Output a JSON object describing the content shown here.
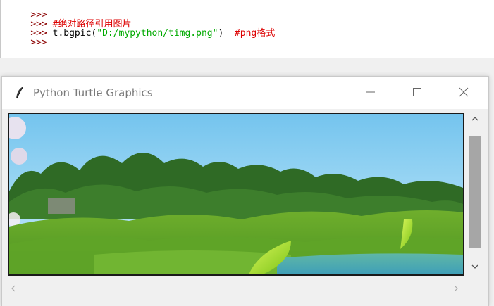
{
  "shell": {
    "lines": [
      {
        "prompt": ">>>",
        "segments": []
      },
      {
        "prompt": ">>>",
        "segments": [
          {
            "kind": "comment",
            "text": " #绝对路径引用图片"
          }
        ]
      },
      {
        "prompt": ">>>",
        "segments": [
          {
            "kind": "code",
            "text": " t.bgpic("
          },
          {
            "kind": "str",
            "text": "\"D:/mypython/timg.png\""
          },
          {
            "kind": "code",
            "text": ")  "
          },
          {
            "kind": "comment",
            "text": "#png格式"
          }
        ]
      },
      {
        "prompt": ">>>",
        "segments": []
      }
    ]
  },
  "turtle_window": {
    "title": "Python Turtle Graphics",
    "icon": "feather-icon",
    "controls": [
      "minimize-icon",
      "maximize-icon",
      "close-icon"
    ]
  },
  "colors": {
    "prompt": "#8b0000",
    "comment": "#dd0000",
    "string": "#00aa00",
    "scroll_thumb": "#a6a6a6"
  },
  "scrollbar": {
    "vertical_position": 0.5,
    "icons": [
      "chevron-up-icon",
      "chevron-down-icon",
      "chevron-left-icon",
      "chevron-right-icon"
    ]
  }
}
